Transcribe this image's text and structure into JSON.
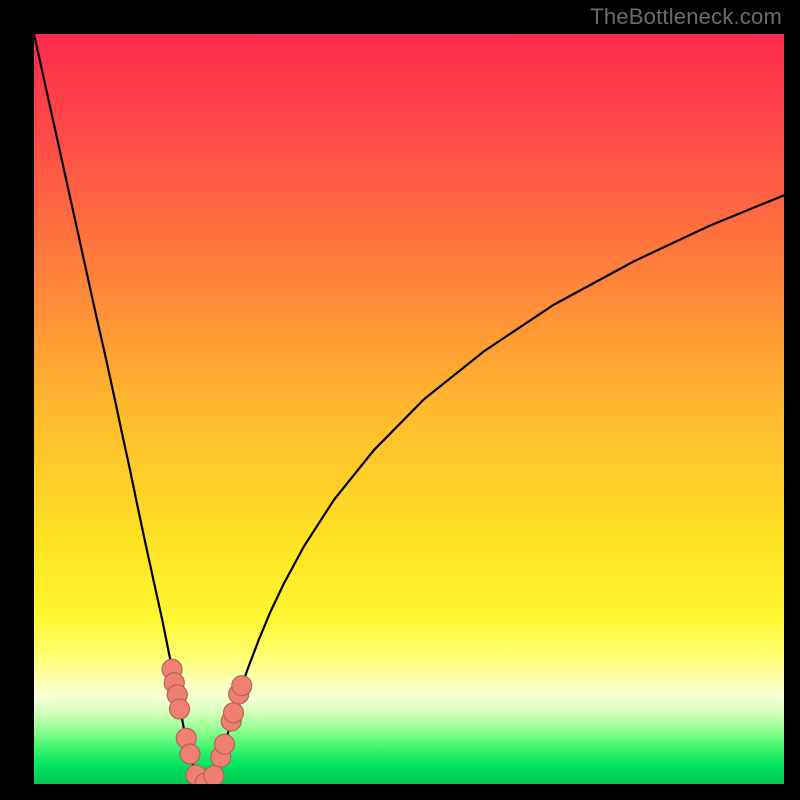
{
  "watermark": "TheBottleneck.com",
  "colors": {
    "frame": "#000000",
    "curve": "#000000",
    "points_fill": "#f08172",
    "points_stroke": "#b36457",
    "gradient_stops": [
      {
        "offset": 0.0,
        "color": "#ff2b4d"
      },
      {
        "offset": 0.12,
        "color": "#ff4748"
      },
      {
        "offset": 0.3,
        "color": "#ff7b3c"
      },
      {
        "offset": 0.5,
        "color": "#ffb92e"
      },
      {
        "offset": 0.68,
        "color": "#ffe324"
      },
      {
        "offset": 0.78,
        "color": "#fff631"
      },
      {
        "offset": 0.83,
        "color": "#ffff73"
      },
      {
        "offset": 0.86,
        "color": "#ffffb0"
      },
      {
        "offset": 0.885,
        "color": "#f6ffd6"
      },
      {
        "offset": 0.905,
        "color": "#d3ffb9"
      },
      {
        "offset": 0.93,
        "color": "#8bff8d"
      },
      {
        "offset": 0.955,
        "color": "#34f36b"
      },
      {
        "offset": 0.975,
        "color": "#00e45e"
      },
      {
        "offset": 1.0,
        "color": "#00c851"
      }
    ]
  },
  "chart_data": {
    "type": "line",
    "title": "",
    "xlabel": "",
    "ylabel": "",
    "x_range": [
      0,
      100
    ],
    "y_range": [
      0,
      100
    ],
    "note": "x is horizontal position (0=left,100=right); y is curve height as percent of plot (0=bottom,100=top). Values estimated from pixels.",
    "series": [
      {
        "name": "bottleneck-curve",
        "x": [
          0.0,
          5.9,
          8.1,
          9.6,
          10.9,
          11.9,
          12.8,
          13.6,
          14.3,
          14.9,
          15.6,
          16.3,
          17.1,
          17.9,
          18.9,
          20.0,
          21.3,
          22.8,
          23.7,
          24.5,
          25.5,
          26.0,
          26.5,
          27.2,
          28.4,
          30.0,
          31.5,
          33.3,
          36.0,
          40.0,
          45.3,
          52.0,
          60.0,
          69.3,
          80.0,
          90.0,
          100.0
        ],
        "y": [
          100.0,
          73.3,
          63.3,
          56.7,
          50.7,
          46.0,
          41.9,
          38.0,
          34.7,
          31.9,
          28.7,
          25.5,
          21.9,
          17.9,
          13.1,
          7.3,
          2.1,
          0.0,
          0.5,
          2.3,
          5.5,
          7.3,
          9.1,
          11.5,
          15.1,
          19.3,
          22.9,
          26.7,
          31.7,
          37.9,
          44.5,
          51.3,
          57.7,
          63.9,
          69.7,
          74.4,
          78.5
        ]
      }
    ],
    "points": [
      {
        "name": "left-cluster",
        "x": 18.4,
        "y": 15.3
      },
      {
        "name": "left-cluster",
        "x": 18.7,
        "y": 13.5
      },
      {
        "name": "left-cluster",
        "x": 19.1,
        "y": 11.9
      },
      {
        "name": "left-cluster",
        "x": 19.4,
        "y": 10.0
      },
      {
        "name": "left-cluster",
        "x": 20.3,
        "y": 6.1
      },
      {
        "name": "left-cluster",
        "x": 20.8,
        "y": 4.0
      },
      {
        "name": "bottom",
        "x": 21.6,
        "y": 1.2
      },
      {
        "name": "bottom",
        "x": 22.8,
        "y": 0.1
      },
      {
        "name": "bottom",
        "x": 24.0,
        "y": 1.1
      },
      {
        "name": "right-cluster",
        "x": 24.9,
        "y": 3.6
      },
      {
        "name": "right-cluster",
        "x": 25.4,
        "y": 5.3
      },
      {
        "name": "right-cluster",
        "x": 26.3,
        "y": 8.4
      },
      {
        "name": "right-cluster",
        "x": 26.6,
        "y": 9.5
      },
      {
        "name": "right-cluster",
        "x": 27.3,
        "y": 12.0
      },
      {
        "name": "right-cluster",
        "x": 27.7,
        "y": 13.1
      }
    ]
  }
}
